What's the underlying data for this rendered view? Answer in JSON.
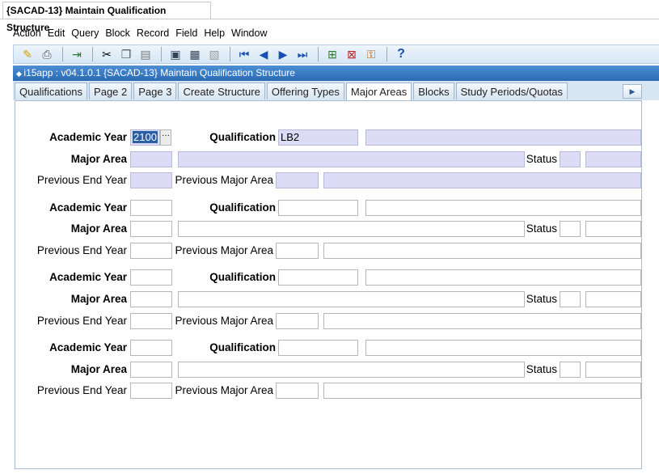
{
  "window": {
    "title": "{SACAD-13} Maintain Qualification Structure"
  },
  "menu": [
    "Action",
    "Edit",
    "Query",
    "Block",
    "Record",
    "Field",
    "Help",
    "Window"
  ],
  "toolbar": {
    "icons": [
      "save-icon",
      "print-icon",
      "exit-icon",
      "cut-icon",
      "copy-icon",
      "paste-icon",
      "enter-query-icon",
      "execute-query-icon",
      "cancel-query-icon",
      "first-record-icon",
      "previous-record-icon",
      "next-record-icon",
      "last-record-icon",
      "insert-record-icon",
      "delete-record-icon",
      "lock-record-icon",
      "help-icon"
    ]
  },
  "form": {
    "header": "i15app : v04.1.0.1  {SACAD-13} Maintain Qualification Structure"
  },
  "tabs": [
    "Qualifications",
    "Page 2",
    "Page 3",
    "Create Structure",
    "Offering Types",
    "Major Areas",
    "Blocks",
    "Study Periods/Quotas"
  ],
  "active_tab": "Major Areas",
  "labels": {
    "academic_year": "Academic Year",
    "qualification": "Qualification",
    "major_area": "Major Area",
    "status": "Status",
    "previous_end_year": "Previous End Year",
    "previous_major_area": "Previous Major Area"
  },
  "records": [
    {
      "academic_year": "2100",
      "qualification": "LB2",
      "qualification_desc": "",
      "major_area": "",
      "major_area_desc": "",
      "status": "",
      "status_desc": "",
      "previous_end_year": "",
      "previous_major_area": "",
      "previous_major_area_desc": ""
    },
    {
      "academic_year": "",
      "qualification": "",
      "qualification_desc": "",
      "major_area": "",
      "major_area_desc": "",
      "status": "",
      "status_desc": "",
      "previous_end_year": "",
      "previous_major_area": "",
      "previous_major_area_desc": ""
    },
    {
      "academic_year": "",
      "qualification": "",
      "qualification_desc": "",
      "major_area": "",
      "major_area_desc": "",
      "status": "",
      "status_desc": "",
      "previous_end_year": "",
      "previous_major_area": "",
      "previous_major_area_desc": ""
    },
    {
      "academic_year": "",
      "qualification": "",
      "qualification_desc": "",
      "major_area": "",
      "major_area_desc": "",
      "status": "",
      "status_desc": "",
      "previous_end_year": "",
      "previous_major_area": "",
      "previous_major_area_desc": ""
    }
  ]
}
